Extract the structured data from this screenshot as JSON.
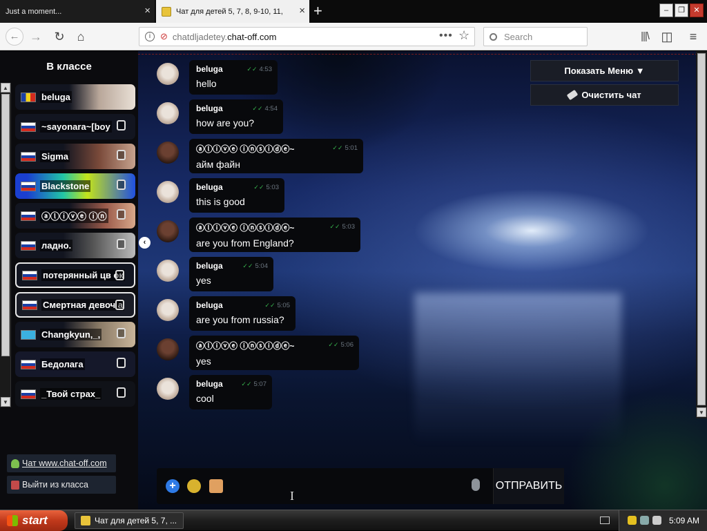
{
  "browser": {
    "tabs": [
      {
        "title": "Just a moment..."
      },
      {
        "title": "Чат для детей 5, 7, 8, 9-10, 11,"
      }
    ],
    "url_prefix": "chatdljadetey.",
    "url_host": "chat-off.com",
    "search_placeholder": "Search"
  },
  "sidebar": {
    "title": "В классе",
    "users": [
      {
        "name": "beluga",
        "flag": "ro"
      },
      {
        "name": "~sayonara~[boy",
        "flag": "ru"
      },
      {
        "name": "Sigma",
        "flag": "ru"
      },
      {
        "name": "Blackstone",
        "flag": "ru"
      },
      {
        "name": "ⓐⓛⓘⓥⓔ ⓘⓝ",
        "flag": "ru"
      },
      {
        "name": "ладно.",
        "flag": "ru"
      },
      {
        "name": "потерянный цв ок",
        "flag": "ru"
      },
      {
        "name": "Смертная девоч а",
        "flag": "ru"
      },
      {
        "name": "Changkyun,_,",
        "flag": "kz"
      },
      {
        "name": "Бедолага",
        "flag": "ru"
      },
      {
        "name": "_Твой страх_",
        "flag": "ru"
      }
    ],
    "site_link": "Чат www.chat-off.com",
    "exit_link": "Выйти из класса"
  },
  "controls": {
    "show_menu": "Показать Меню ▼",
    "clear_chat": "Очистить чат"
  },
  "messages": [
    {
      "author": "beluga",
      "time": "4:53",
      "text": "hello"
    },
    {
      "author": "beluga",
      "time": "4:54",
      "text": "how are you?"
    },
    {
      "author": "ⓐⓛⓘⓥⓔ ⓘⓝⓢⓘⓓⓔ~",
      "time": "5:01",
      "text": "айм файн"
    },
    {
      "author": "beluga",
      "time": "5:03",
      "text": "this  is good"
    },
    {
      "author": "ⓐⓛⓘⓥⓔ ⓘⓝⓢⓘⓓⓔ~",
      "time": "5:03",
      "text": "are you from England?"
    },
    {
      "author": "beluga",
      "time": "5:04",
      "text": "yes"
    },
    {
      "author": "beluga",
      "time": "5:05",
      "text": "are you from russia?"
    },
    {
      "author": "ⓐⓛⓘⓥⓔ ⓘⓝⓢⓘⓓⓔ~",
      "time": "5:06",
      "text": "yes"
    },
    {
      "author": "beluga",
      "time": "5:07",
      "text": "cool"
    }
  ],
  "composer": {
    "send_label": "ОТПРАВИТЬ",
    "cursor": "I"
  },
  "taskbar": {
    "start_label": "start",
    "task_item": "Чат для детей 5, 7, ...",
    "clock": "5:09 AM"
  }
}
